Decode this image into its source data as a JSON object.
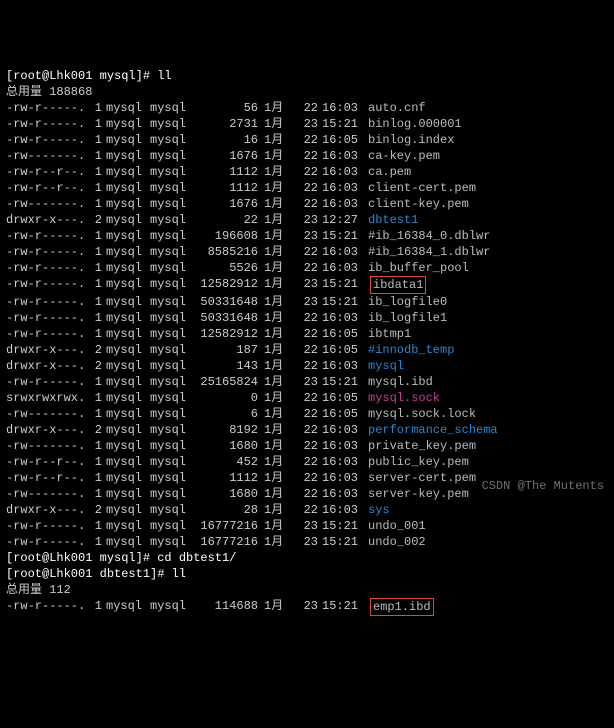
{
  "prompt1": "[root@Lhk001 mysql]# ll",
  "total1_label": "总用量",
  "total1_value": "188868",
  "rows": [
    {
      "perms": "-rw-r-----.",
      "links": "1",
      "own": "mysql",
      "grp": "mysql",
      "size": "56",
      "mon": "1月",
      "day": "22",
      "time": "16:03",
      "name": "auto.cnf",
      "cls": "file"
    },
    {
      "perms": "-rw-r-----.",
      "links": "1",
      "own": "mysql",
      "grp": "mysql",
      "size": "2731",
      "mon": "1月",
      "day": "23",
      "time": "15:21",
      "name": "binlog.000001",
      "cls": "file"
    },
    {
      "perms": "-rw-r-----.",
      "links": "1",
      "own": "mysql",
      "grp": "mysql",
      "size": "16",
      "mon": "1月",
      "day": "22",
      "time": "16:05",
      "name": "binlog.index",
      "cls": "file"
    },
    {
      "perms": "-rw-------.",
      "links": "1",
      "own": "mysql",
      "grp": "mysql",
      "size": "1676",
      "mon": "1月",
      "day": "22",
      "time": "16:03",
      "name": "ca-key.pem",
      "cls": "file"
    },
    {
      "perms": "-rw-r--r--.",
      "links": "1",
      "own": "mysql",
      "grp": "mysql",
      "size": "1112",
      "mon": "1月",
      "day": "22",
      "time": "16:03",
      "name": "ca.pem",
      "cls": "file"
    },
    {
      "perms": "-rw-r--r--.",
      "links": "1",
      "own": "mysql",
      "grp": "mysql",
      "size": "1112",
      "mon": "1月",
      "day": "22",
      "time": "16:03",
      "name": "client-cert.pem",
      "cls": "file"
    },
    {
      "perms": "-rw-------.",
      "links": "1",
      "own": "mysql",
      "grp": "mysql",
      "size": "1676",
      "mon": "1月",
      "day": "22",
      "time": "16:03",
      "name": "client-key.pem",
      "cls": "file"
    },
    {
      "perms": "drwxr-x---.",
      "links": "2",
      "own": "mysql",
      "grp": "mysql",
      "size": "22",
      "mon": "1月",
      "day": "23",
      "time": "12:27",
      "name": "dbtest1",
      "cls": "dir"
    },
    {
      "perms": "-rw-r-----.",
      "links": "1",
      "own": "mysql",
      "grp": "mysql",
      "size": "196608",
      "mon": "1月",
      "day": "23",
      "time": "15:21",
      "name": "#ib_16384_0.dblwr",
      "cls": "file"
    },
    {
      "perms": "-rw-r-----.",
      "links": "1",
      "own": "mysql",
      "grp": "mysql",
      "size": "8585216",
      "mon": "1月",
      "day": "22",
      "time": "16:03",
      "name": "#ib_16384_1.dblwr",
      "cls": "file"
    },
    {
      "perms": "-rw-r-----.",
      "links": "1",
      "own": "mysql",
      "grp": "mysql",
      "size": "5526",
      "mon": "1月",
      "day": "22",
      "time": "16:03",
      "name": "ib_buffer_pool",
      "cls": "file"
    },
    {
      "perms": "-rw-r-----.",
      "links": "1",
      "own": "mysql",
      "grp": "mysql",
      "size": "12582912",
      "mon": "1月",
      "day": "23",
      "time": "15:21",
      "name": "ibdata1",
      "cls": "file",
      "boxed": true
    },
    {
      "perms": "-rw-r-----.",
      "links": "1",
      "own": "mysql",
      "grp": "mysql",
      "size": "50331648",
      "mon": "1月",
      "day": "23",
      "time": "15:21",
      "name": "ib_logfile0",
      "cls": "file"
    },
    {
      "perms": "-rw-r-----.",
      "links": "1",
      "own": "mysql",
      "grp": "mysql",
      "size": "50331648",
      "mon": "1月",
      "day": "22",
      "time": "16:03",
      "name": "ib_logfile1",
      "cls": "file"
    },
    {
      "perms": "-rw-r-----.",
      "links": "1",
      "own": "mysql",
      "grp": "mysql",
      "size": "12582912",
      "mon": "1月",
      "day": "22",
      "time": "16:05",
      "name": "ibtmp1",
      "cls": "file"
    },
    {
      "perms": "drwxr-x---.",
      "links": "2",
      "own": "mysql",
      "grp": "mysql",
      "size": "187",
      "mon": "1月",
      "day": "22",
      "time": "16:05",
      "name": "#innodb_temp",
      "cls": "dir"
    },
    {
      "perms": "drwxr-x---.",
      "links": "2",
      "own": "mysql",
      "grp": "mysql",
      "size": "143",
      "mon": "1月",
      "day": "22",
      "time": "16:03",
      "name": "mysql",
      "cls": "dir"
    },
    {
      "perms": "-rw-r-----.",
      "links": "1",
      "own": "mysql",
      "grp": "mysql",
      "size": "25165824",
      "mon": "1月",
      "day": "23",
      "time": "15:21",
      "name": "mysql.ibd",
      "cls": "file"
    },
    {
      "perms": "srwxrwxrwx.",
      "links": "1",
      "own": "mysql",
      "grp": "mysql",
      "size": "0",
      "mon": "1月",
      "day": "22",
      "time": "16:05",
      "name": "mysql.sock",
      "cls": "sock"
    },
    {
      "perms": "-rw-------.",
      "links": "1",
      "own": "mysql",
      "grp": "mysql",
      "size": "6",
      "mon": "1月",
      "day": "22",
      "time": "16:05",
      "name": "mysql.sock.lock",
      "cls": "file"
    },
    {
      "perms": "drwxr-x---.",
      "links": "2",
      "own": "mysql",
      "grp": "mysql",
      "size": "8192",
      "mon": "1月",
      "day": "22",
      "time": "16:03",
      "name": "performance_schema",
      "cls": "dir"
    },
    {
      "perms": "-rw-------.",
      "links": "1",
      "own": "mysql",
      "grp": "mysql",
      "size": "1680",
      "mon": "1月",
      "day": "22",
      "time": "16:03",
      "name": "private_key.pem",
      "cls": "file"
    },
    {
      "perms": "-rw-r--r--.",
      "links": "1",
      "own": "mysql",
      "grp": "mysql",
      "size": "452",
      "mon": "1月",
      "day": "22",
      "time": "16:03",
      "name": "public_key.pem",
      "cls": "file"
    },
    {
      "perms": "-rw-r--r--.",
      "links": "1",
      "own": "mysql",
      "grp": "mysql",
      "size": "1112",
      "mon": "1月",
      "day": "22",
      "time": "16:03",
      "name": "server-cert.pem",
      "cls": "file"
    },
    {
      "perms": "-rw-------.",
      "links": "1",
      "own": "mysql",
      "grp": "mysql",
      "size": "1680",
      "mon": "1月",
      "day": "22",
      "time": "16:03",
      "name": "server-key.pem",
      "cls": "file"
    },
    {
      "perms": "drwxr-x---.",
      "links": "2",
      "own": "mysql",
      "grp": "mysql",
      "size": "28",
      "mon": "1月",
      "day": "22",
      "time": "16:03",
      "name": "sys",
      "cls": "dir"
    },
    {
      "perms": "-rw-r-----.",
      "links": "1",
      "own": "mysql",
      "grp": "mysql",
      "size": "16777216",
      "mon": "1月",
      "day": "23",
      "time": "15:21",
      "name": "undo_001",
      "cls": "file"
    },
    {
      "perms": "-rw-r-----.",
      "links": "1",
      "own": "mysql",
      "grp": "mysql",
      "size": "16777216",
      "mon": "1月",
      "day": "23",
      "time": "15:21",
      "name": "undo_002",
      "cls": "file"
    }
  ],
  "prompt2": "[root@Lhk001 mysql]# cd dbtest1/",
  "prompt3": "[root@Lhk001 dbtest1]# ll",
  "total2_label": "总用量",
  "total2_value": "112",
  "rows2": [
    {
      "perms": "-rw-r-----.",
      "links": "1",
      "own": "mysql",
      "grp": "mysql",
      "size": "114688",
      "mon": "1月",
      "day": "23",
      "time": "15:21",
      "name": "emp1.ibd",
      "cls": "file",
      "boxed": true
    }
  ],
  "watermark": "CSDN @The Mutents"
}
